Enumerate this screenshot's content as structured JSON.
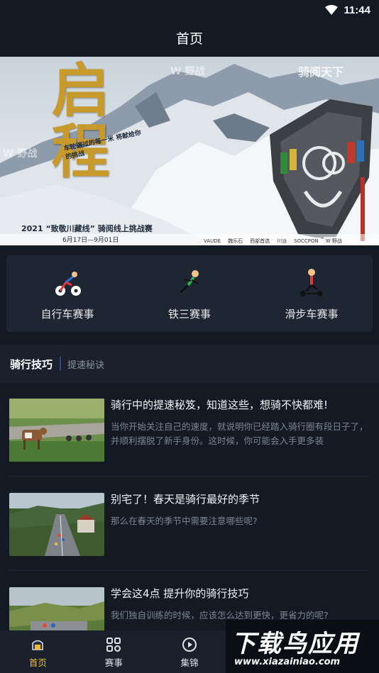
{
  "status": {
    "time": "11:44"
  },
  "header": {
    "title": "首页"
  },
  "banner": {
    "title": "启程",
    "slogan": "车轮碾过的每一米 将献给你的挑战",
    "subtitle": "2021 “致敬川藏线” 骑阅线上挑战赛",
    "date": "6月17日—9月01日",
    "brand": "骑阅天下",
    "watermark": "W 野战",
    "logos": [
      "VAUDE",
      "魏乐石",
      "西部首选",
      "川派",
      "SOCCPON",
      "W 野战"
    ]
  },
  "categories": [
    {
      "label": "自行车赛事",
      "icon": "bicycle-rider-icon"
    },
    {
      "label": "铁三赛事",
      "icon": "triathlon-runner-icon"
    },
    {
      "label": "滑步车赛事",
      "icon": "balance-bike-icon"
    }
  ],
  "section": {
    "title": "骑行技巧",
    "subtitle": "提速秘诀"
  },
  "articles": [
    {
      "title": "骑行中的提速秘笈，知道这些，想骑不快都难!",
      "desc": "当你开始关注自己的速度，就说明你已经踏入骑行圈有段日子了，并顺利摆脱了新手身份。这时候，你可能会入手更多装"
    },
    {
      "title": "别宅了！春天是骑行最好的季节",
      "desc": "那么在春天的季节中需要注意哪些呢?"
    },
    {
      "title": "学会这4点 提升你的骑行技巧",
      "desc": "我们独自训练的时候，应该怎么达到更快，更省力的呢?"
    }
  ],
  "tabs": [
    {
      "label": "首页",
      "icon": "home-icon",
      "active": true
    },
    {
      "label": "赛事",
      "icon": "grid-icon",
      "active": false
    },
    {
      "label": "集锦",
      "icon": "play-icon",
      "active": false
    },
    {
      "label": "",
      "icon": "",
      "active": false
    },
    {
      "label": "",
      "icon": "",
      "active": false
    }
  ],
  "watermark": {
    "text": "下载鸟应用",
    "url": "www.xiazainiao.com"
  },
  "colors": {
    "background": "#131a24",
    "card": "#1e2633",
    "accent": "#f0b93a",
    "section_divider": "#2b4a7a"
  }
}
